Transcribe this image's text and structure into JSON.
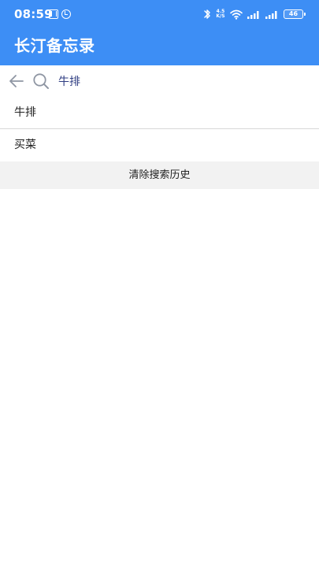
{
  "status_bar": {
    "time": "08:59",
    "network_speed_value": "4.5",
    "network_speed_unit": "K/S",
    "battery": "46"
  },
  "app": {
    "title": "长汀备忘录"
  },
  "search": {
    "query": "牛排"
  },
  "history": {
    "items": [
      {
        "label": "牛排"
      },
      {
        "label": "买菜"
      }
    ],
    "clear_label": "清除搜索历史"
  },
  "icons": {
    "back": "arrow-left-icon",
    "search": "search-icon",
    "bluetooth": "bluetooth-icon",
    "wifi": "wifi-icon",
    "signal": "signal-bars-icon",
    "battery": "battery-icon"
  },
  "colors": {
    "header": "#3d8ef5",
    "search_text": "#2f3d82",
    "clear_background": "#f2f2f2"
  }
}
